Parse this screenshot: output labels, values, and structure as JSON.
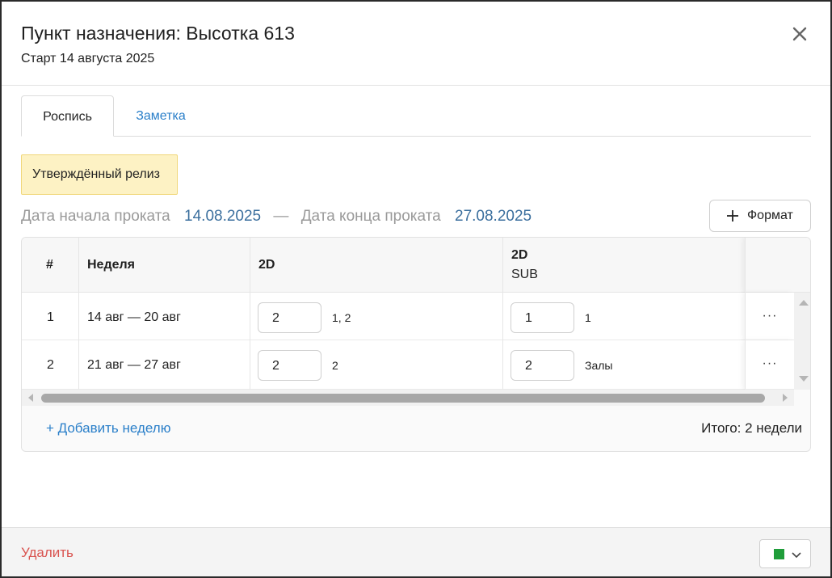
{
  "header": {
    "title": "Пункт назначения: Высотка 613",
    "subtitle": "Старт 14 августа 2025"
  },
  "tabs": [
    {
      "label": "Роспись",
      "active": true
    },
    {
      "label": "Заметка",
      "active": false
    }
  ],
  "status_badge": "Утверждённый релиз",
  "dates": {
    "start_label": "Дата начала проката",
    "start_value": "14.08.2025",
    "separator": "—",
    "end_label": "Дата конца проката",
    "end_value": "27.08.2025"
  },
  "format_button": {
    "label": "Формат",
    "icon": "plus-icon"
  },
  "table": {
    "columns": {
      "num": "#",
      "week": "Неделя",
      "format1": {
        "title": "2D",
        "sub": ""
      },
      "format2": {
        "title": "2D",
        "sub": "SUB"
      }
    },
    "rows": [
      {
        "num": "1",
        "week": "14 авг — 20 авг",
        "f1_value": "2",
        "f1_halls": "1, 2",
        "f2_value": "1",
        "f2_halls": "1",
        "menu": "···"
      },
      {
        "num": "2",
        "week": "21 авг — 27 авг",
        "f1_value": "2",
        "f1_halls": "2",
        "f2_value": "2",
        "f2_halls": "Залы",
        "menu": "···"
      }
    ],
    "add_week": "+ Добавить неделю",
    "total": "Итого: 2 недели"
  },
  "footer": {
    "delete_label": "Удалить",
    "color_value": "#1f9d3a",
    "color_icon": "chevron-down-icon"
  },
  "colors": {
    "accent": "#2a7fc9",
    "danger": "#d9534f",
    "badge_bg": "#fdf2c4",
    "date_value": "#3b6f9e"
  }
}
